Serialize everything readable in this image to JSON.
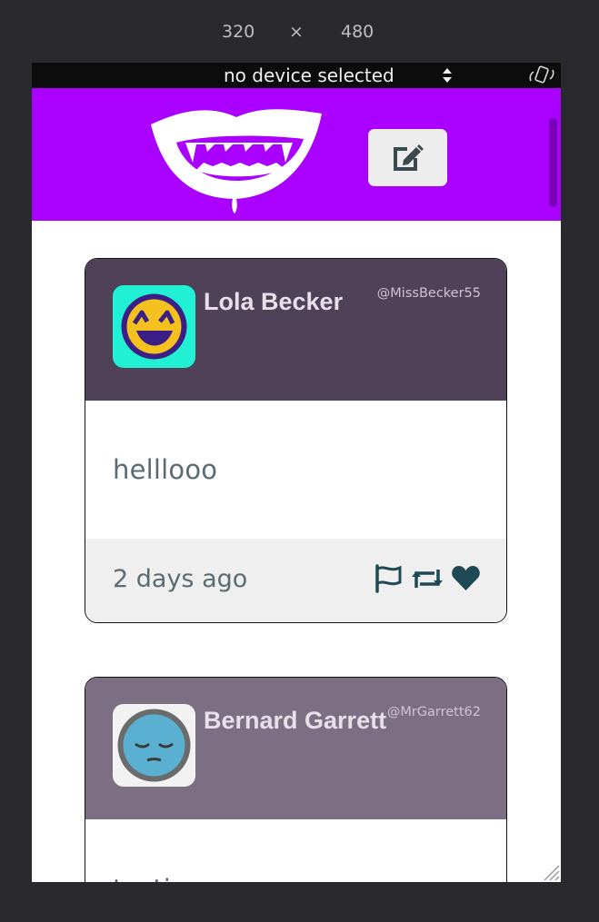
{
  "toolbar": {
    "width": "320",
    "times": "×",
    "height": "480"
  },
  "device_bar": {
    "selected": "no device selected",
    "rotate_icon": "rotate-device-icon"
  },
  "header": {
    "logo": "vampire-mouth-logo",
    "compose_icon": "edit-icon",
    "background": "#aa00ff"
  },
  "tweets": [
    {
      "name": "Lola Becker",
      "handle": "@MissBecker55",
      "text": "helllooo",
      "time": "2 days ago",
      "header_color": "#4e4158",
      "icons": [
        "flag-icon",
        "retweet-icon",
        "heart-icon"
      ]
    },
    {
      "name": "Bernard Garrett",
      "handle": "@MrGarrett62",
      "text": "testing",
      "header_color": "#7c6f83"
    }
  ]
}
